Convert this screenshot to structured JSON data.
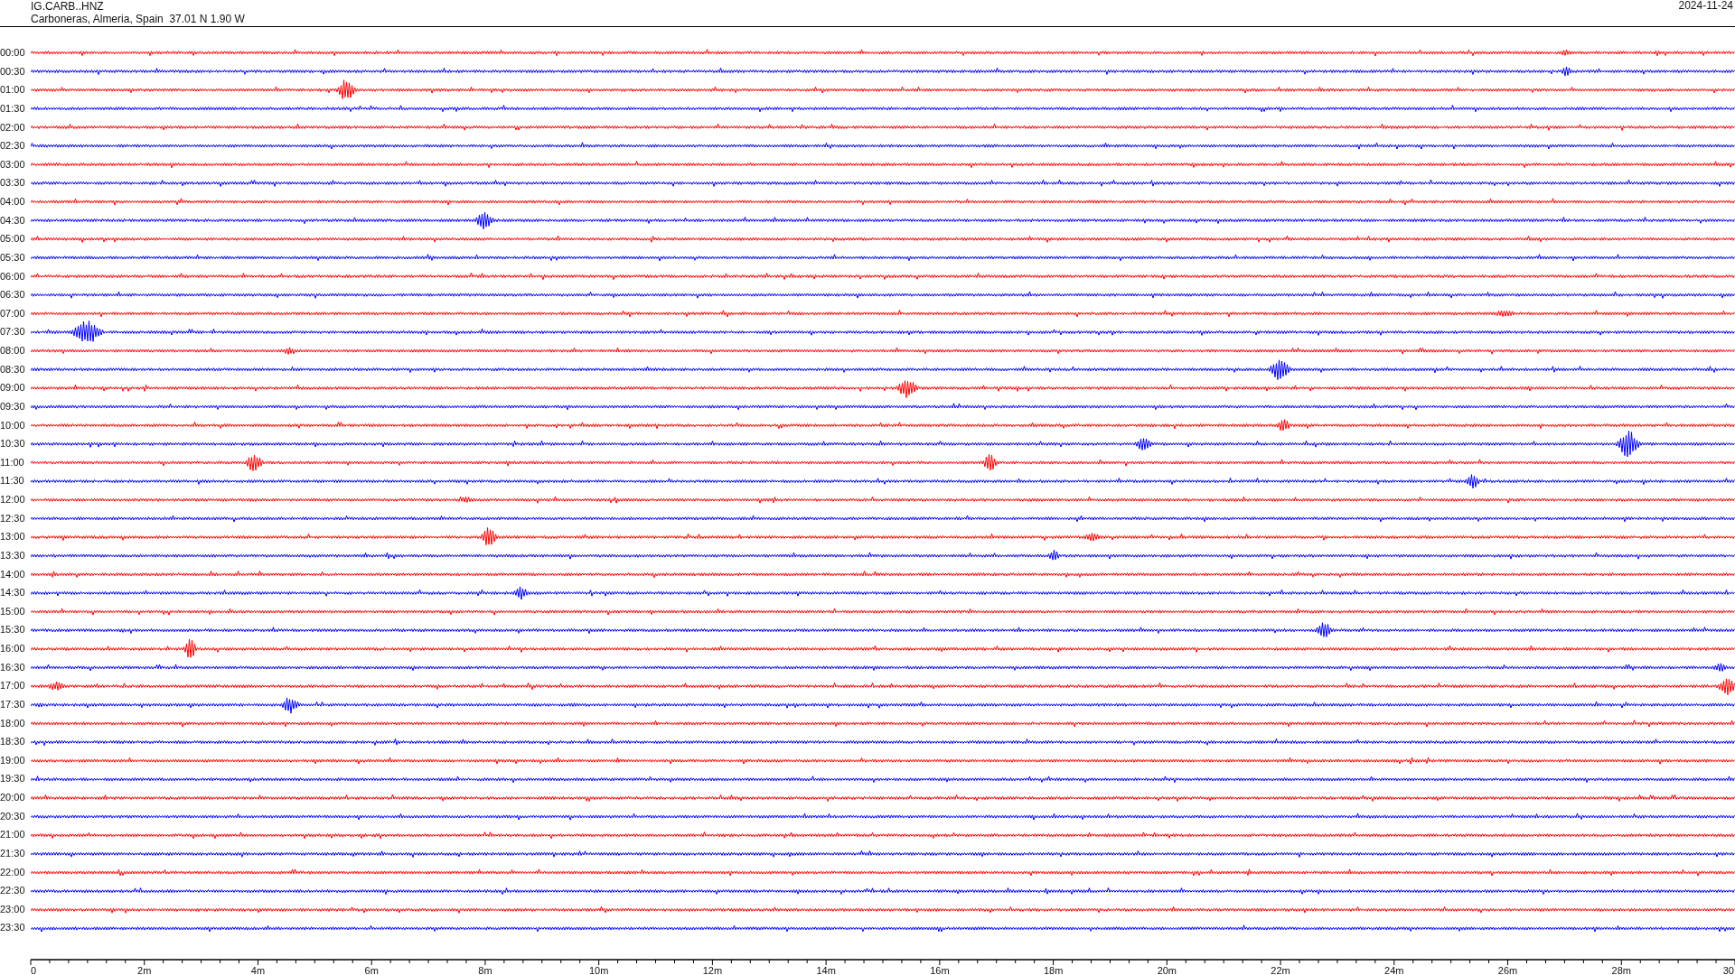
{
  "header": {
    "station": "IG.CARB..HNZ",
    "location": "Carboneras, Almeria, Spain  37.01 N 1.90 W",
    "date": "2024-11-24"
  },
  "rows": [
    {
      "time": "00:00",
      "color": "#ff0000"
    },
    {
      "time": "00:30",
      "color": "#0000ff"
    },
    {
      "time": "01:00",
      "color": "#ff0000"
    },
    {
      "time": "01:30",
      "color": "#0000ff"
    },
    {
      "time": "02:00",
      "color": "#ff0000"
    },
    {
      "time": "02:30",
      "color": "#0000ff"
    },
    {
      "time": "03:00",
      "color": "#ff0000"
    },
    {
      "time": "03:30",
      "color": "#0000ff"
    },
    {
      "time": "04:00",
      "color": "#ff0000"
    },
    {
      "time": "04:30",
      "color": "#0000ff"
    },
    {
      "time": "05:00",
      "color": "#ff0000"
    },
    {
      "time": "05:30",
      "color": "#0000ff"
    },
    {
      "time": "06:00",
      "color": "#ff0000"
    },
    {
      "time": "06:30",
      "color": "#0000ff"
    },
    {
      "time": "07:00",
      "color": "#ff0000"
    },
    {
      "time": "07:30",
      "color": "#0000ff"
    },
    {
      "time": "08:00",
      "color": "#ff0000"
    },
    {
      "time": "08:30",
      "color": "#0000ff"
    },
    {
      "time": "09:00",
      "color": "#ff0000"
    },
    {
      "time": "09:30",
      "color": "#0000ff"
    },
    {
      "time": "10:00",
      "color": "#ff0000"
    },
    {
      "time": "10:30",
      "color": "#0000ff"
    },
    {
      "time": "11:00",
      "color": "#ff0000"
    },
    {
      "time": "11:30",
      "color": "#0000ff"
    },
    {
      "time": "12:00",
      "color": "#ff0000"
    },
    {
      "time": "12:30",
      "color": "#0000ff"
    },
    {
      "time": "13:00",
      "color": "#ff0000"
    },
    {
      "time": "13:30",
      "color": "#0000ff"
    },
    {
      "time": "14:00",
      "color": "#ff0000"
    },
    {
      "time": "14:30",
      "color": "#0000ff"
    },
    {
      "time": "15:00",
      "color": "#ff0000"
    },
    {
      "time": "15:30",
      "color": "#0000ff"
    },
    {
      "time": "16:00",
      "color": "#ff0000"
    },
    {
      "time": "16:30",
      "color": "#0000ff"
    },
    {
      "time": "17:00",
      "color": "#ff0000"
    },
    {
      "time": "17:30",
      "color": "#0000ff"
    },
    {
      "time": "18:00",
      "color": "#ff0000"
    },
    {
      "time": "18:30",
      "color": "#0000ff"
    },
    {
      "time": "19:00",
      "color": "#ff0000"
    },
    {
      "time": "19:30",
      "color": "#0000ff"
    },
    {
      "time": "20:00",
      "color": "#ff0000"
    },
    {
      "time": "20:30",
      "color": "#0000ff"
    },
    {
      "time": "21:00",
      "color": "#ff0000"
    },
    {
      "time": "21:30",
      "color": "#0000ff"
    },
    {
      "time": "22:00",
      "color": "#ff0000"
    },
    {
      "time": "22:30",
      "color": "#0000ff"
    },
    {
      "time": "23:00",
      "color": "#ff0000"
    },
    {
      "time": "23:30",
      "color": "#0000ff"
    }
  ],
  "x_axis": {
    "ticks": [
      "0",
      "2m",
      "4m",
      "6m",
      "8m",
      "10m",
      "12m",
      "14m",
      "16m",
      "18m",
      "20m",
      "22m",
      "24m",
      "26m",
      "28m",
      "30"
    ]
  }
}
